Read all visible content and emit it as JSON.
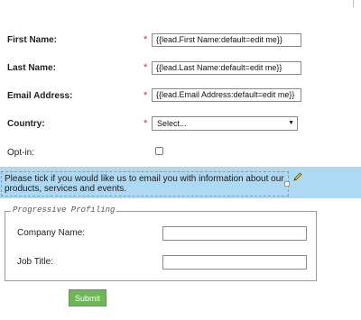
{
  "form": {
    "fields": [
      {
        "label": "First Name:",
        "required_mark": "*",
        "value": "{{lead.First Name:default=edit me}}"
      },
      {
        "label": "Last Name:",
        "required_mark": "*",
        "value": "{{lead.Last Name:default=edit me}}"
      },
      {
        "label": "Email Address:",
        "required_mark": "*",
        "value": "{{lead.Email Address:default=edit me}}"
      }
    ],
    "country": {
      "label": "Country:",
      "required_mark": "*",
      "selected": "Select...",
      "arrow": "▼"
    },
    "optin": {
      "label": "Opt-in:",
      "checked": false
    },
    "banner": {
      "text": "Please tick if you would like us to email you with information about our products, services and events.",
      "icon": "pencil-icon"
    },
    "progressive": {
      "legend": "Progressive Profiling",
      "fields": [
        {
          "label": "Company Name:",
          "value": ""
        },
        {
          "label": "Job Title:",
          "value": ""
        }
      ]
    },
    "submit_label": "Submit"
  },
  "colors": {
    "banner": "#aed9f2",
    "required": "#d03030",
    "submit": "#6fb65a"
  }
}
